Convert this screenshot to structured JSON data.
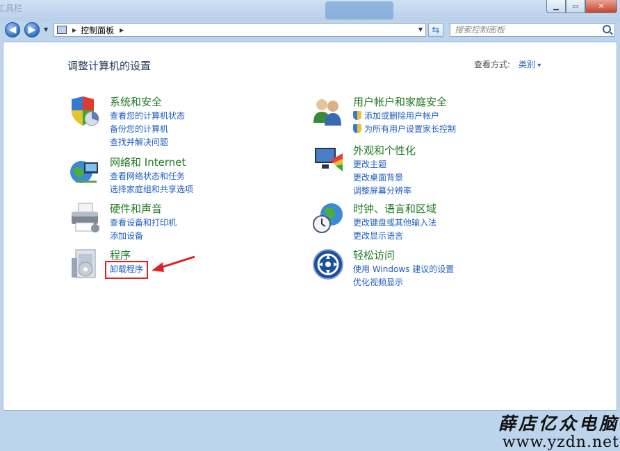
{
  "window": {
    "title_blur": "工具栏",
    "minimize": "▁",
    "maximize": "▭",
    "close": "✕"
  },
  "nav": {
    "back": "◀",
    "forward": "▶",
    "address_crumb": "控制面板",
    "search_placeholder": "搜索控制面板"
  },
  "header": {
    "title": "调整计算机的设置",
    "view_by_label": "查看方式:",
    "view_by_value": "类别"
  },
  "categories": [
    {
      "title": "系统和安全",
      "icon": "shield-security-icon",
      "links": [
        "查看您的计算机状态",
        "备份您的计算机",
        "查找并解决问题"
      ]
    },
    {
      "title": "网络和 Internet",
      "icon": "network-globe-icon",
      "links": [
        "查看网络状态和任务",
        "选择家庭组和共享选项"
      ]
    },
    {
      "title": "硬件和声音",
      "icon": "printer-icon",
      "links": [
        "查看设备和打印机",
        "添加设备"
      ]
    },
    {
      "title": "程序",
      "icon": "programs-icon",
      "links": [
        "卸载程序"
      ]
    },
    {
      "title": "用户帐户和家庭安全",
      "icon": "users-icon",
      "links": [
        "添加或删除用户帐户",
        "为所有用户设置家长控制"
      ]
    },
    {
      "title": "外观和个性化",
      "icon": "appearance-icon",
      "links": [
        "更改主题",
        "更改桌面背景",
        "调整屏幕分辨率"
      ]
    },
    {
      "title": "时钟、语言和区域",
      "icon": "clock-globe-icon",
      "links": [
        "更改键盘或其他输入法",
        "更改显示语言"
      ]
    },
    {
      "title": "轻松访问",
      "icon": "ease-of-access-icon",
      "links": [
        "使用 Windows 建议的设置",
        "优化视频显示"
      ]
    }
  ],
  "watermark": {
    "line1": "薛店亿众电脑",
    "line2": "www.yzdn.net"
  },
  "colors": {
    "category_title": "#1e7a1e",
    "link": "#1e5ec4",
    "heading": "#1e395b",
    "highlight": "#e02020"
  }
}
